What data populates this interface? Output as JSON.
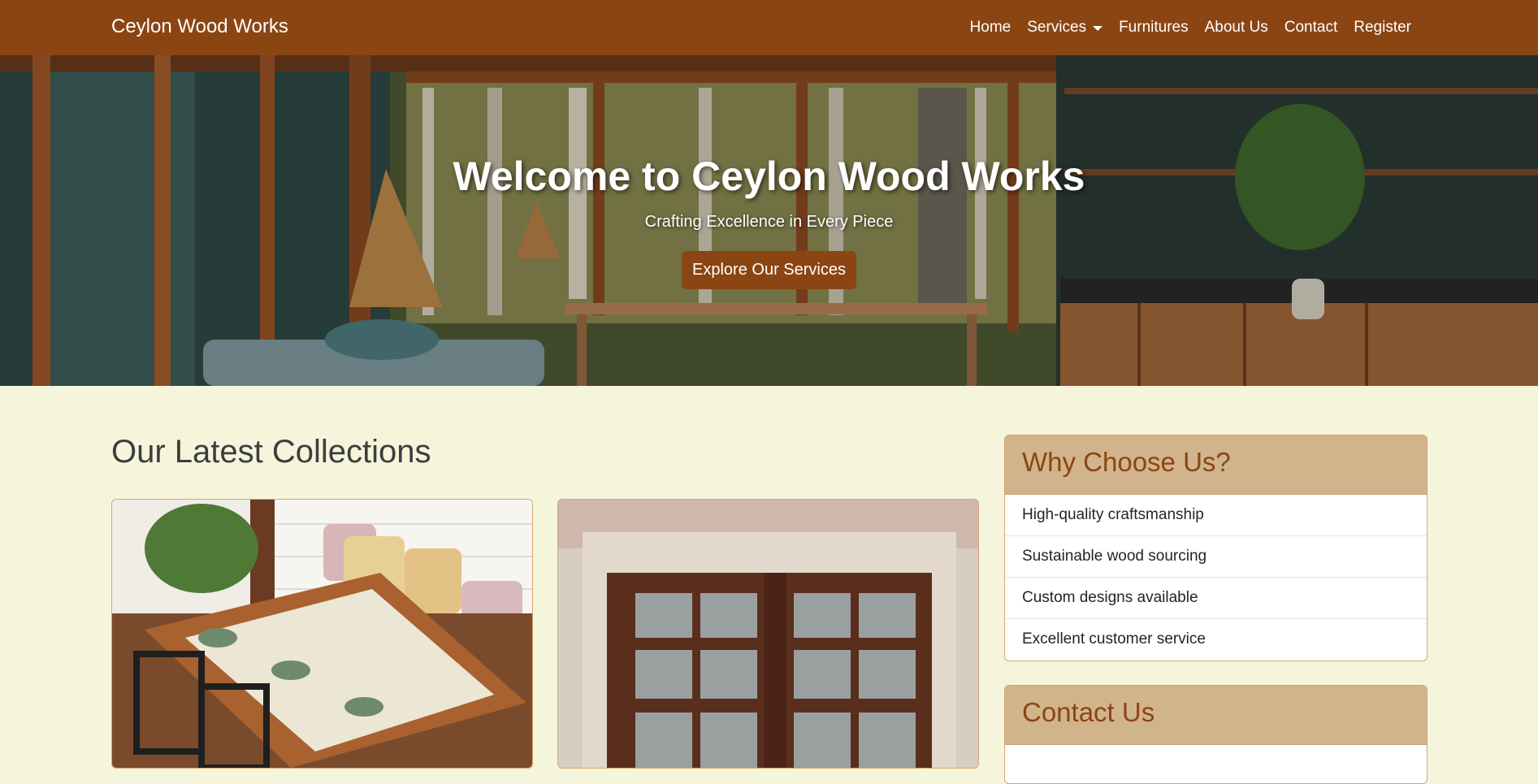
{
  "navbar": {
    "brand": "Ceylon Wood Works",
    "links": [
      {
        "label": "Home"
      },
      {
        "label": "Services"
      },
      {
        "label": "Furnitures"
      },
      {
        "label": "About Us"
      },
      {
        "label": "Contact"
      },
      {
        "label": "Register"
      }
    ]
  },
  "hero": {
    "title": "Welcome to Ceylon Wood Works",
    "subtitle": "Crafting Excellence in Every Piece",
    "button": "Explore Our Services"
  },
  "collections": {
    "title": "Our Latest Collections"
  },
  "why": {
    "title": "Why Choose Us?",
    "items": [
      "High-quality craftsmanship",
      "Sustainable wood sourcing",
      "Custom designs available",
      "Excellent customer service"
    ]
  },
  "contact": {
    "title": "Contact Us"
  },
  "colors": {
    "brand": "#8b4513",
    "background": "#f5f5dc",
    "panel_header": "#d2b48c"
  }
}
